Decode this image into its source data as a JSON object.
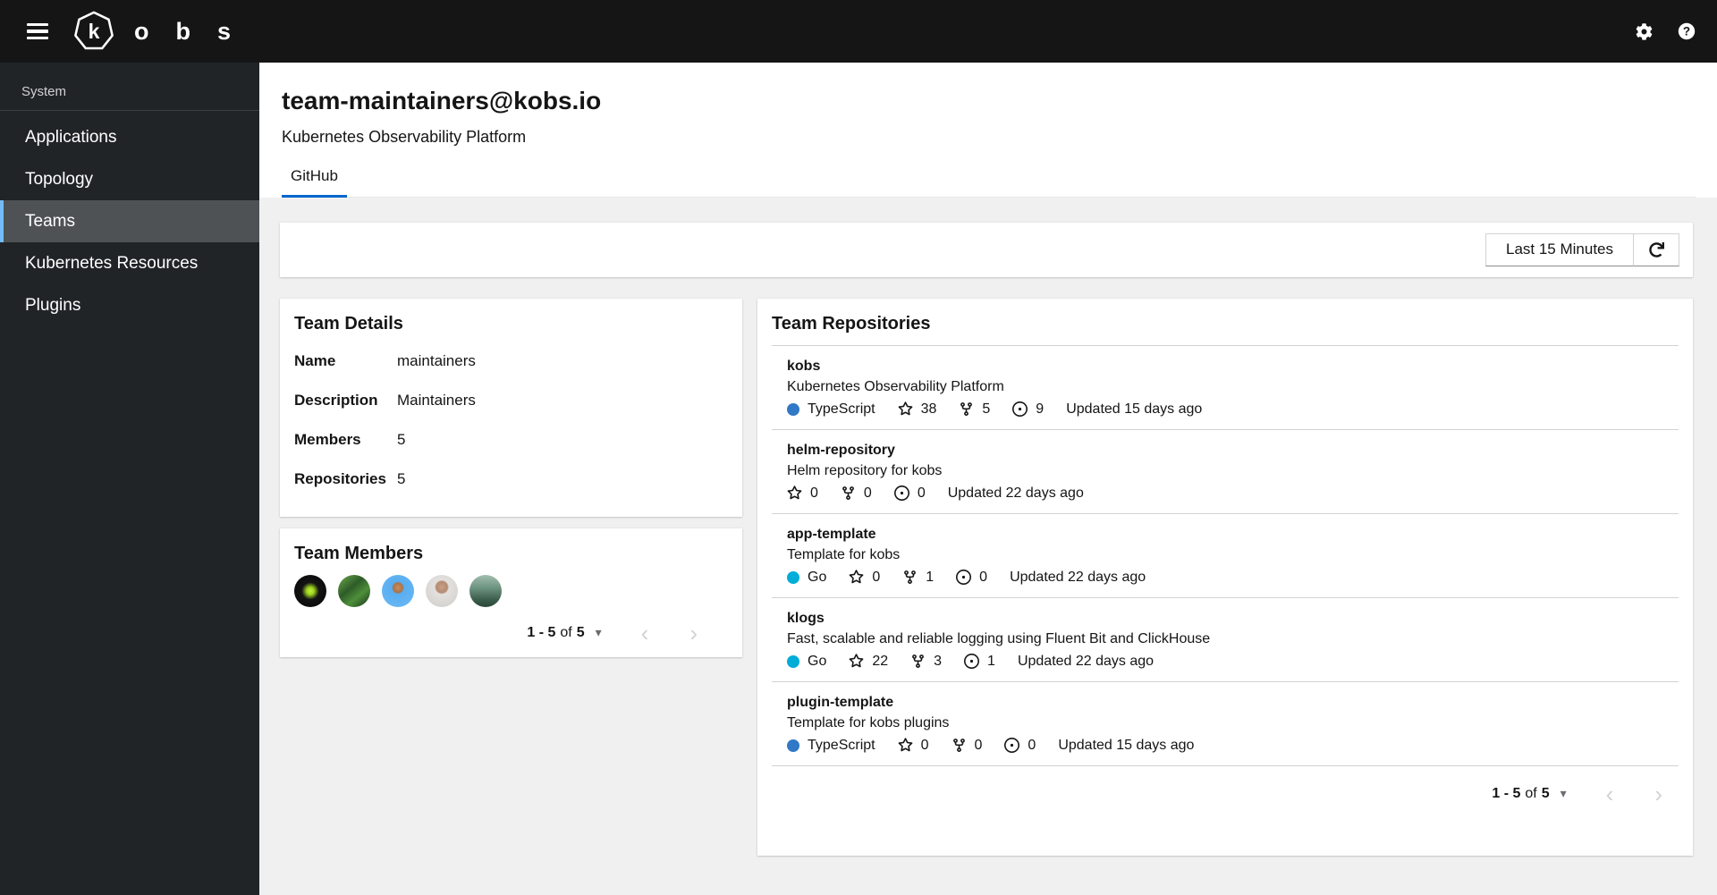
{
  "masthead": {
    "logo_letter": "k",
    "brand_rest": "obs"
  },
  "sidebar": {
    "group_label": "System",
    "items": [
      {
        "label": "Applications"
      },
      {
        "label": "Topology"
      },
      {
        "label": "Teams"
      },
      {
        "label": "Kubernetes Resources"
      },
      {
        "label": "Plugins"
      }
    ]
  },
  "page": {
    "title": "team-maintainers@kobs.io",
    "subtitle": "Kubernetes Observability Platform"
  },
  "tabs": [
    {
      "label": "GitHub"
    }
  ],
  "toolbar": {
    "time_range_label": "Last 15 Minutes"
  },
  "team_details": {
    "title": "Team Details",
    "rows": [
      {
        "label": "Name",
        "value": "maintainers"
      },
      {
        "label": "Description",
        "value": "Maintainers"
      },
      {
        "label": "Members",
        "value": "5"
      },
      {
        "label": "Repositories",
        "value": "5"
      }
    ]
  },
  "team_members": {
    "title": "Team Members",
    "avatars": [
      {
        "gradient": "radial-gradient(circle at 50% 50%, #c8f03c 0%, #9bd41f 16%, #141414 38%, #050505 100%)"
      },
      {
        "gradient": "linear-gradient(140deg, #6fae4e 0%, #2e5b28 40%, #4e8f3a 65%, #16301a 100%)"
      },
      {
        "gradient": "radial-gradient(circle at 50% 40%, #c98e5a 0%, #a9744a 20%, #58aef0 24%, #6cb9f5 100%)"
      },
      {
        "gradient": "radial-gradient(circle at 50% 38%, #c9a188 0%, #b48a72 22%, #e3e1df 28%, #cfccc9 100%)"
      },
      {
        "gradient": "linear-gradient(180deg, #a3bdae 0%, #6d9480 40%, #3a5c4a 78%, #2c4638 100%)"
      }
    ],
    "pagination": {
      "range": "1 - 5",
      "of_label": "of",
      "total": "5"
    }
  },
  "team_repositories": {
    "title": "Team Repositories",
    "repos": [
      {
        "name": "kobs",
        "description": "Kubernetes Observability Platform",
        "language": "TypeScript",
        "language_color": "#3178c6",
        "stars": "38",
        "forks": "5",
        "issues": "9",
        "updated": "Updated 15 days ago"
      },
      {
        "name": "helm-repository",
        "description": "Helm repository for kobs",
        "language": "",
        "language_color": "",
        "stars": "0",
        "forks": "0",
        "issues": "0",
        "updated": "Updated 22 days ago"
      },
      {
        "name": "app-template",
        "description": "Template for kobs",
        "language": "Go",
        "language_color": "#00add8",
        "stars": "0",
        "forks": "1",
        "issues": "0",
        "updated": "Updated 22 days ago"
      },
      {
        "name": "klogs",
        "description": "Fast, scalable and reliable logging using Fluent Bit and ClickHouse",
        "language": "Go",
        "language_color": "#00add8",
        "stars": "22",
        "forks": "3",
        "issues": "1",
        "updated": "Updated 22 days ago"
      },
      {
        "name": "plugin-template",
        "description": "Template for kobs plugins",
        "language": "TypeScript",
        "language_color": "#3178c6",
        "stars": "0",
        "forks": "0",
        "issues": "0",
        "updated": "Updated 15 days ago"
      }
    ],
    "pagination": {
      "range": "1 - 5",
      "of_label": "of",
      "total": "5"
    }
  },
  "icons": {
    "caret_down": "▾",
    "chevron_left": "‹",
    "chevron_right": "›"
  },
  "colors": {
    "accent": "#0066cc",
    "nav_selected_border": "#73bcf7",
    "typescript": "#3178c6",
    "go": "#00add8"
  }
}
